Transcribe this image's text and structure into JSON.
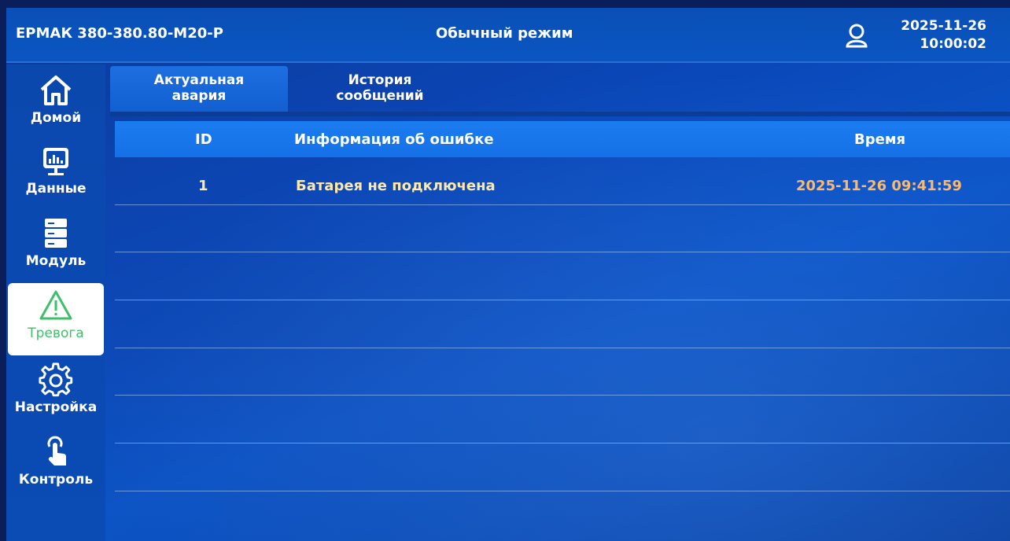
{
  "header": {
    "device_name": "ЕРМАК 380-380.80-М20-Р",
    "mode": "Обычный режим",
    "date": "2025-11-26",
    "time": "10:00:02",
    "user_icon": "user-icon"
  },
  "sidebar": {
    "items": [
      {
        "label": "Домой",
        "icon": "home-icon",
        "active": false
      },
      {
        "label": "Данные",
        "icon": "monitor-chart-icon",
        "active": false
      },
      {
        "label": "Модуль",
        "icon": "server-rack-icon",
        "active": false
      },
      {
        "label": "Тревога",
        "icon": "warning-triangle-icon",
        "active": true
      },
      {
        "label": "Настройка",
        "icon": "gear-icon",
        "active": false
      },
      {
        "label": "Контроль",
        "icon": "touch-hand-icon",
        "active": false
      }
    ]
  },
  "tabs": [
    {
      "label_line1": "Актуальная",
      "label_line2": "авария",
      "active": true
    },
    {
      "label_line1": "История",
      "label_line2": "сообщений",
      "active": false
    }
  ],
  "table": {
    "columns": [
      "ID",
      "Информация об ошибке",
      "Время"
    ],
    "rows": [
      {
        "id": "1",
        "info": "Батарея не подключена",
        "time": "2025-11-26 09:41:59"
      }
    ]
  },
  "colors": {
    "active_label": "#3fbf6a",
    "row_text": "#ffe9a8",
    "time_text": "#ffb86a",
    "header_bg": "#0b56c2"
  }
}
